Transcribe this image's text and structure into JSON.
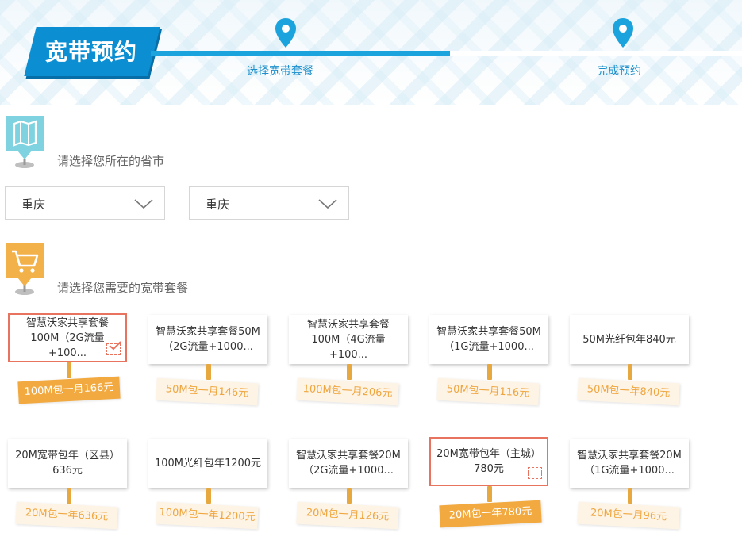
{
  "header": {
    "title": "宽带预约",
    "steps": [
      {
        "label": "选择宽带套餐"
      },
      {
        "label": "完成预约"
      }
    ]
  },
  "location": {
    "heading": "请选择您所在的省市",
    "icon": "map-icon",
    "province": "重庆",
    "city": "重庆"
  },
  "packages": {
    "heading": "请选择您需要的宽带套餐",
    "icon": "shopping-cart-icon",
    "items": [
      {
        "name": "智慧沃家共享套餐100M（2G流量+100...",
        "price": "100M包一月166元",
        "selected": true
      },
      {
        "name": "智慧沃家共享套餐50M（2G流量+1000...",
        "price": "50M包一月146元",
        "selected": false
      },
      {
        "name": "智慧沃家共享套餐100M（4G流量+100...",
        "price": "100M包一月206元",
        "selected": false
      },
      {
        "name": "智慧沃家共享套餐50M（1G流量+1000...",
        "price": "50M包一月116元",
        "selected": false
      },
      {
        "name": "50M光纤包年840元",
        "price": "50M包一年840元",
        "selected": false
      },
      {
        "name": "20M宽带包年（区县）636元",
        "price": "20M包一年636元",
        "selected": false
      },
      {
        "name": "100M光纤包年1200元",
        "price": "100M包一年1200元",
        "selected": false
      },
      {
        "name": "智慧沃家共享套餐20M（2G流量+1000...",
        "price": "20M包一月126元",
        "selected": false
      },
      {
        "name": "20M宽带包年（主城）780元",
        "price": "20M包一年780元",
        "selected": true
      },
      {
        "name": "智慧沃家共享套餐20M（1G流量+1000...",
        "price": "20M包一月96元",
        "selected": false
      }
    ]
  },
  "colors": {
    "brand_blue": "#0b8fd2",
    "accent_orange": "#f2a93f",
    "selected_border": "#e8735f"
  }
}
